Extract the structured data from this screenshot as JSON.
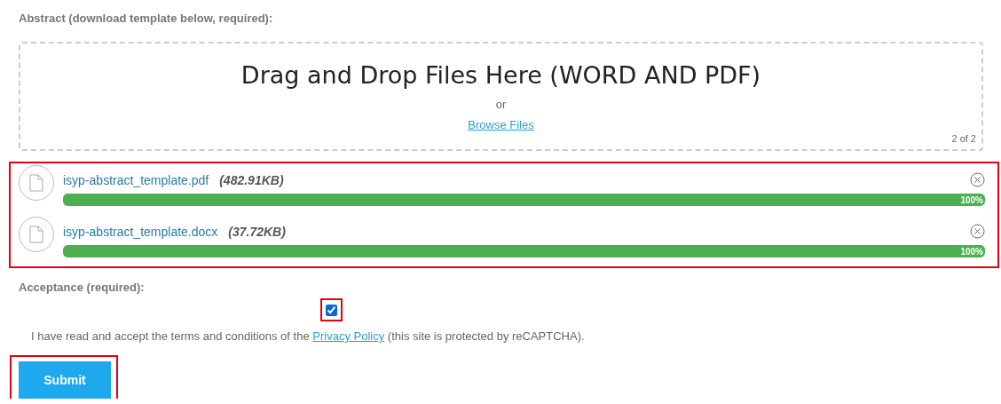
{
  "abstract": {
    "label": "Abstract (download template below, required):",
    "dropzone": {
      "title": "Drag and Drop Files Here (WORD AND PDF)",
      "or": "or",
      "browse": "Browse Files",
      "count": "2 of 2"
    },
    "files_highlighted": true,
    "files": [
      {
        "name": "isyp-abstract_template.pdf",
        "size": "(482.91KB)",
        "level": 1,
        "percent": "100%"
      },
      {
        "name": "isyp-abstract_template.docx",
        "size": "(37.72KB)",
        "level": 1,
        "percent": "100%"
      }
    ]
  },
  "acceptance": {
    "label": "Acceptance (required):",
    "checked": true,
    "highlighted": true,
    "text_before": "I have read and accept the terms and conditions of the",
    "link": "Privacy Policy",
    "text_after": "(this site is protected by reCAPTCHA)."
  },
  "submit": {
    "label": "Submit",
    "highlighted": true
  }
}
